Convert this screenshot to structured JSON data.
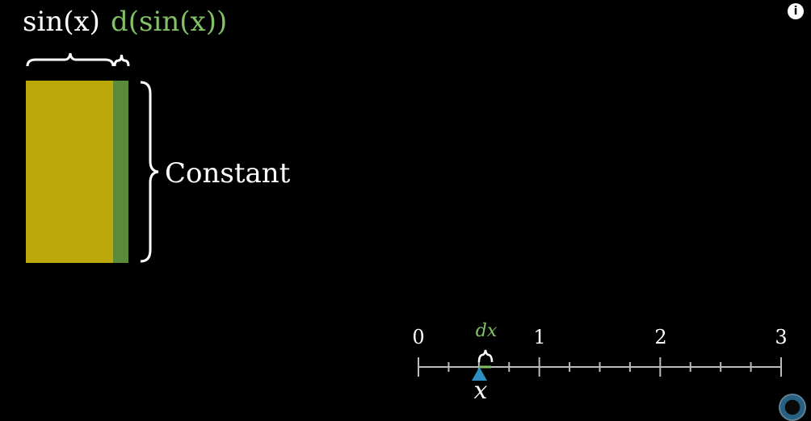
{
  "labels": {
    "sin_x": "sin(x)",
    "d_sin_x": "d(sin(x))",
    "constant": "Constant",
    "dx": "dx",
    "x": "x"
  },
  "number_line": {
    "min": 0,
    "max": 3,
    "major_ticks": [
      "0",
      "1",
      "2",
      "3"
    ],
    "minor_step": 0.25,
    "marker_value": 0.5
  },
  "colors": {
    "yellow_rect": "#BBA80A",
    "green_strip": "#5B8A3A",
    "green_text": "#83C167",
    "white": "#FFFFFF",
    "marker": "#2E8FC0",
    "axis": "#BBBBBB"
  },
  "icons": {
    "info": "info-icon",
    "logo": "channel-logo-icon"
  },
  "info_glyph": "i"
}
